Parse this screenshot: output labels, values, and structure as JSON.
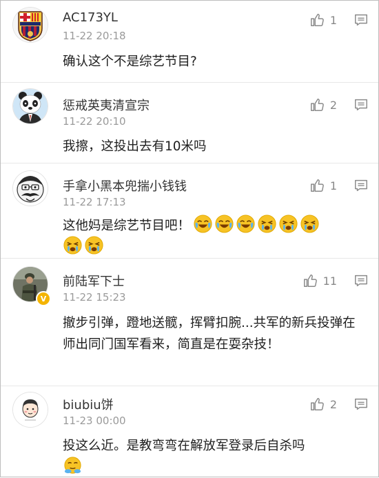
{
  "comments": [
    {
      "username": "AC173YL",
      "timestamp": "11-22 20:18",
      "likes": "1",
      "text": "确认这个不是综艺节目?",
      "avatar": "fc-barcelona-crest"
    },
    {
      "username": "惩戒英夷清宣宗",
      "timestamp": "11-22 20:10",
      "likes": "2",
      "text": "我擦，这投出去有10米吗",
      "avatar": "panda-suit"
    },
    {
      "username": "手拿小黑本兜揣小钱钱",
      "timestamp": "11-22 17:13",
      "likes": "1",
      "text": "这他妈是综艺节目吧！",
      "emojis": [
        "laugh-cry-emoji",
        "laugh-cry-emoji",
        "laugh-cry-emoji",
        "crying-emoji",
        "crying-emoji",
        "crying-emoji",
        "crying-emoji",
        "crying-emoji"
      ],
      "avatar": "mustache-face"
    },
    {
      "username": "前陆军下士",
      "timestamp": "11-22 15:23",
      "likes": "11",
      "text": "撤步引弹，蹬地送髋，挥臂扣腕...共军的新兵投弹在师出同门国军看来，简直是在耍杂技！",
      "avatar": "soldier-photo",
      "verified": "V"
    },
    {
      "username": "biubiu饼",
      "timestamp": "11-23 00:00",
      "likes": "2",
      "text": "投这么近。是教弯弯在解放军登录后自杀吗",
      "emojis": [
        "thinking-emoji"
      ],
      "avatar": "cartoon-face"
    }
  ],
  "icons": {
    "like": "thumbs-up-icon",
    "reply": "comment-icon"
  },
  "colors": {
    "text": "#1f1f1f",
    "meta": "#9a9a9a",
    "divider": "#e7e7e7",
    "emoji": "#f7c325",
    "verified": "#f4b400"
  }
}
